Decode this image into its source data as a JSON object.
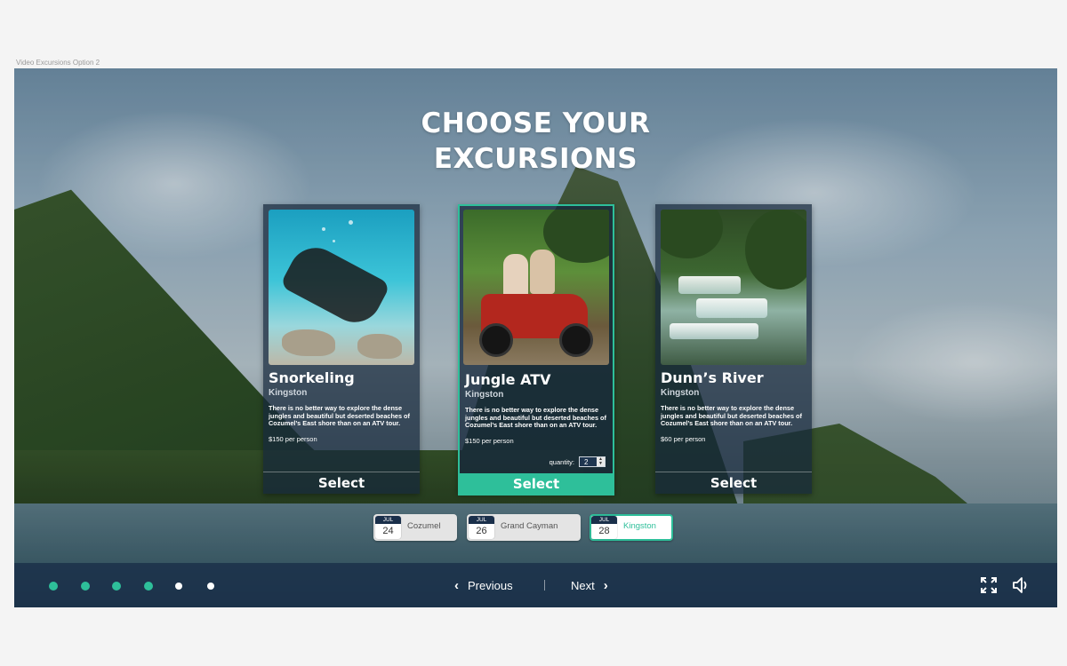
{
  "frame_caption": "Video Excursions Option 2",
  "title": {
    "line1": "CHOOSE YOUR",
    "line2": "EXCURSIONS"
  },
  "cards": [
    {
      "title": "Snorkeling",
      "location": "Kingston",
      "description": "There is no better way to explore the dense jungles and beautiful but deserted beaches of Cozumel’s East shore than on an ATV tour.",
      "price": "$150 per person",
      "select_label": "Select",
      "selected": false
    },
    {
      "title": "Jungle ATV",
      "location": "Kingston",
      "description": "There is no better way to explore the dense jungles and beautiful but deserted beaches of Cozumel’s East shore than on an ATV tour.",
      "price": "$150 per person",
      "quantity_label": "quantity:",
      "quantity_value": "2",
      "select_label": "Select",
      "selected": true
    },
    {
      "title": "Dunn’s River",
      "location": "Kingston",
      "description": "There is no better way to explore the dense jungles and beautiful but deserted beaches of Cozumel’s East shore than on an ATV tour.",
      "price": "$60 per person",
      "select_label": "Select",
      "selected": false
    }
  ],
  "ports": [
    {
      "month": "JUL",
      "day": "24",
      "name": "Cozumel",
      "active": false
    },
    {
      "month": "JUL",
      "day": "26",
      "name": "Grand Cayman",
      "active": false
    },
    {
      "month": "JUL",
      "day": "28",
      "name": "Kingston",
      "active": true
    }
  ],
  "progress": {
    "total_steps": 6,
    "completed_steps": 4,
    "completed_color": "#2ebf9a",
    "pending_color": "#ffffff"
  },
  "navigation": {
    "previous_label": "Previous",
    "next_label": "Next",
    "previous_icon": "chevron-left-icon",
    "next_icon": "chevron-right-icon"
  },
  "controls": {
    "fullscreen_icon": "fullscreen-icon",
    "volume_icon": "volume-icon"
  },
  "colors": {
    "accent": "#2ebf9a",
    "panel": "#162838"
  }
}
